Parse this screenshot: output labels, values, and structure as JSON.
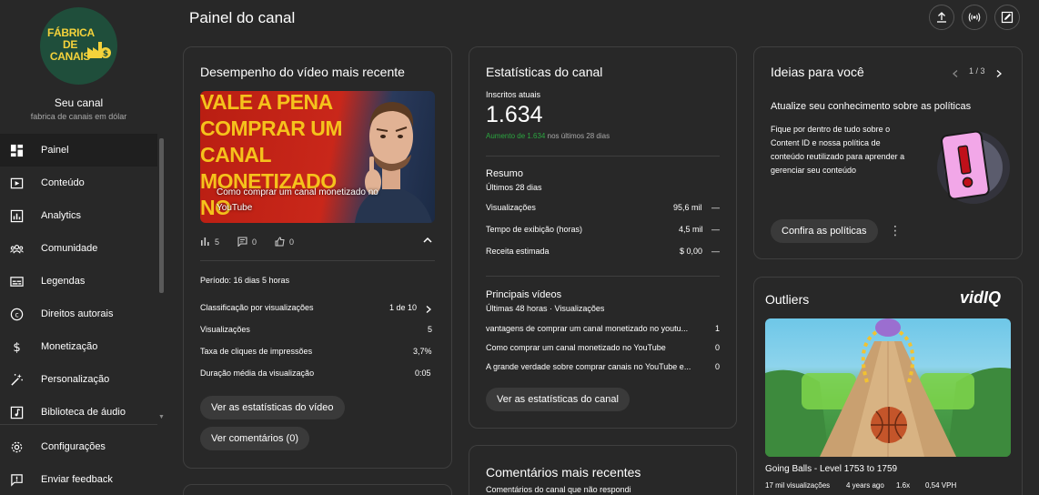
{
  "sidebar": {
    "avatar_text": "FÁBRICA DE CANAIS",
    "channel_name": "Seu canal",
    "channel_handle": "fabrica de canais em dólar",
    "items": [
      {
        "label": "Painel",
        "icon": "dashboard-icon",
        "active": true
      },
      {
        "label": "Conteúdo",
        "icon": "content-icon"
      },
      {
        "label": "Analytics",
        "icon": "analytics-icon"
      },
      {
        "label": "Comunidade",
        "icon": "community-icon"
      },
      {
        "label": "Legendas",
        "icon": "subtitles-icon"
      },
      {
        "label": "Direitos autorais",
        "icon": "copyright-icon"
      },
      {
        "label": "Monetização",
        "icon": "monetization-icon"
      },
      {
        "label": "Personalização",
        "icon": "customization-icon"
      },
      {
        "label": "Biblioteca de áudio",
        "icon": "audio-library-icon"
      }
    ],
    "bottom_items": [
      {
        "label": "Configurações",
        "icon": "gear-icon"
      },
      {
        "label": "Enviar feedback",
        "icon": "feedback-icon"
      }
    ]
  },
  "header": {
    "title": "Painel do canal",
    "buttons": [
      "upload-icon",
      "live-icon",
      "edit-icon"
    ]
  },
  "latest_video": {
    "title": "Desempenho do vídeo mais recente",
    "thumb_text": "VALE A PENA COMPRAR UM CANAL MONETIZADO NO YOUTUBE?",
    "caption": "Como comprar um canal monetizado no YouTube",
    "views_count": "5",
    "comments_count": "0",
    "likes_count": "0",
    "period": "Período: 16 dias 5 horas",
    "rows": [
      {
        "label": "Classificação por visualizações",
        "value": "1 de 10"
      },
      {
        "label": "Visualizações",
        "value": "5"
      },
      {
        "label": "Taxa de cliques de impressões",
        "value": "3,7%"
      },
      {
        "label": "Duração média da visualização",
        "value": "0:05"
      }
    ],
    "btn_stats": "Ver as estatísticas do vídeo",
    "btn_comments": "Ver comentários (0)"
  },
  "channel_stats": {
    "title": "Estatísticas do canal",
    "subs_label": "Inscritos atuais",
    "subs_value": "1.634",
    "subs_delta": "Aumento de 1.634",
    "subs_delta_suffix": "nos últimos 28 dias",
    "summary_title": "Resumo",
    "summary_period": "Últimos 28 dias",
    "summary_rows": [
      {
        "label": "Visualizações",
        "value": "95,6 mil",
        "trend": "—"
      },
      {
        "label": "Tempo de exibição (horas)",
        "value": "4,5 mil",
        "trend": "—"
      },
      {
        "label": "Receita estimada",
        "value": "$ 0,00",
        "trend": "—"
      }
    ],
    "top_title": "Principais vídeos",
    "top_period": "Últimas 48 horas · Visualizações",
    "top_rows": [
      {
        "label": "vantagens de comprar um canal monetizado no youtu...",
        "value": "1"
      },
      {
        "label": "Como comprar um canal monetizado no YouTube",
        "value": "0"
      },
      {
        "label": "A grande verdade sobre comprar canais no YouTube e...",
        "value": "0"
      }
    ],
    "btn": "Ver as estatísticas do canal"
  },
  "comments": {
    "title": "Comentários mais recentes",
    "subtitle": "Comentários do canal que não respondi"
  },
  "ideas": {
    "title": "Ideias para você",
    "pager": "1 / 3",
    "heading": "Atualize seu conhecimento sobre as políticas",
    "body": "Fique por dentro de tudo sobre o Content ID e nossa política de conteúdo reutilizado para aprender a gerenciar seu conteúdo",
    "btn": "Confira as políticas"
  },
  "outliers": {
    "title": "Outliers",
    "brand": "vidIQ",
    "video_title": "Going Balls - Level 1753 to 1759",
    "meta_views": "17 mil visualizações",
    "meta_age": "4 years ago",
    "multiplier": "1.6x",
    "vph": "0,54 VPH"
  },
  "colors": {
    "background": "#282828",
    "accent_green": "#2ba640",
    "muted": "#aaaaaa"
  }
}
